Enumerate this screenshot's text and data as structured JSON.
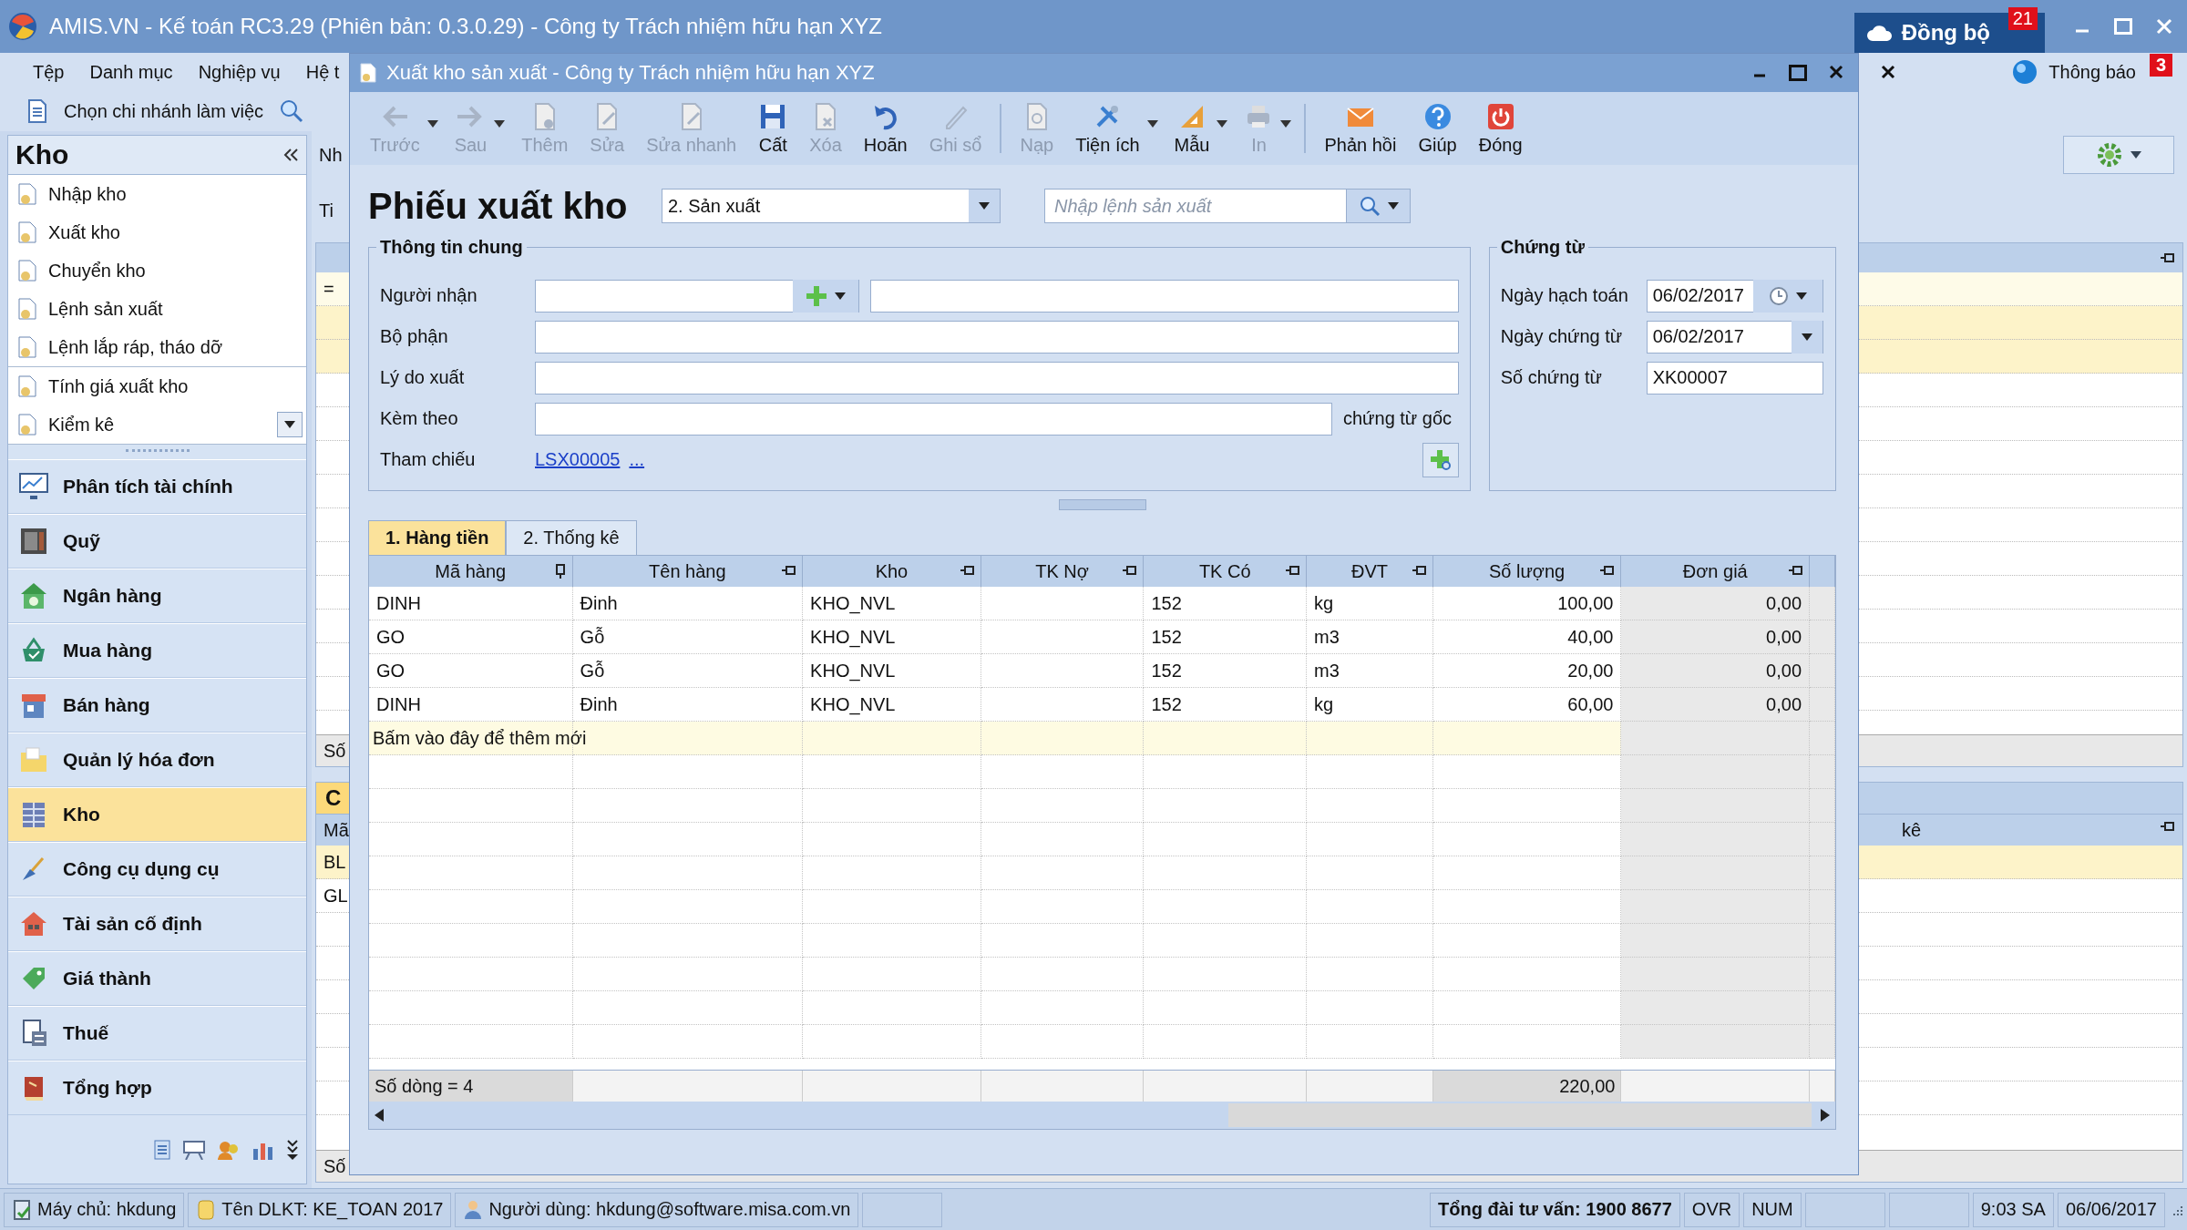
{
  "app_window": {
    "title": "AMIS.VN - Kế toán RC3.29 (Phiên bản: 0.3.0.29) - Công ty Trách nhiệm hữu hạn XYZ",
    "sync_button": {
      "label": "Đồng bộ",
      "badge": "21"
    }
  },
  "menu_bar": {
    "items": [
      "Tệp",
      "Danh mục",
      "Nghiệp vụ",
      "Hệ t"
    ],
    "notifications": {
      "label": "Thông báo",
      "badge": "3"
    }
  },
  "branch_bar": {
    "label": "Chọn chi nhánh làm việc"
  },
  "sidebar": {
    "title": "Kho",
    "item_groups": [
      [
        {
          "label": "Nhập kho",
          "has_menu": false
        },
        {
          "label": "Xuất kho",
          "has_menu": false
        },
        {
          "label": "Chuyển kho",
          "has_menu": false
        },
        {
          "label": "Lệnh sản xuất",
          "has_menu": false
        },
        {
          "label": "Lệnh lắp ráp, tháo dỡ",
          "has_menu": false
        }
      ],
      [
        {
          "label": "Tính giá xuất kho",
          "has_menu": false
        },
        {
          "label": "Kiểm kê",
          "has_menu": true
        }
      ]
    ],
    "modules": [
      {
        "label": "Phân tích tài chính",
        "selected": false
      },
      {
        "label": "Quỹ",
        "selected": false
      },
      {
        "label": "Ngân hàng",
        "selected": false
      },
      {
        "label": "Mua hàng",
        "selected": false
      },
      {
        "label": "Bán hàng",
        "selected": false
      },
      {
        "label": "Quản lý hóa đơn",
        "selected": false
      },
      {
        "label": "Kho",
        "selected": true
      },
      {
        "label": "Công cụ dụng cụ",
        "selected": false
      },
      {
        "label": "Tài sản cố định",
        "selected": false
      },
      {
        "label": "Giá thành",
        "selected": false
      },
      {
        "label": "Thuế",
        "selected": false
      },
      {
        "label": "Tổng hợp",
        "selected": false
      }
    ]
  },
  "background_panel": {
    "tab": "Nh",
    "label": "Ti",
    "upper_grid": {
      "filter_symbol": "=",
      "footer": "Số"
    },
    "lower_grid": {
      "header": "C",
      "columns": [
        "Mã",
        "kê"
      ],
      "rows": [
        "BL",
        "GL"
      ],
      "footer": "Số"
    }
  },
  "dialog": {
    "title": "Xuất kho sản xuất - Công ty Trách nhiệm hữu hạn XYZ",
    "toolbar_groups": [
      [
        {
          "label": "Trước",
          "disabled": true,
          "dropdown": true
        },
        {
          "label": "Sau",
          "disabled": true,
          "dropdown": true
        },
        {
          "label": "Thêm",
          "disabled": true,
          "dropdown": false
        },
        {
          "label": "Sửa",
          "disabled": true,
          "dropdown": false
        },
        {
          "label": "Sửa nhanh",
          "disabled": true,
          "dropdown": false
        },
        {
          "label": "Cất",
          "disabled": false,
          "dropdown": false
        },
        {
          "label": "Xóa",
          "disabled": true,
          "dropdown": false
        },
        {
          "label": "Hoãn",
          "disabled": false,
          "dropdown": false
        },
        {
          "label": "Ghi sổ",
          "disabled": true,
          "dropdown": false
        }
      ],
      [
        {
          "label": "Nạp",
          "disabled": true,
          "dropdown": false
        },
        {
          "label": "Tiện ích",
          "disabled": false,
          "dropdown": true
        },
        {
          "label": "Mẫu",
          "disabled": false,
          "dropdown": true
        },
        {
          "label": "In",
          "disabled": true,
          "dropdown": true
        }
      ],
      [
        {
          "label": "Phản hồi",
          "disabled": false,
          "dropdown": false
        },
        {
          "label": "Giúp",
          "disabled": false,
          "dropdown": false
        },
        {
          "label": "Đóng",
          "disabled": false,
          "dropdown": false
        }
      ]
    ],
    "voucher_title": "Phiếu xuất kho",
    "type_select": {
      "value": "2. Sản xuất"
    },
    "order_search": {
      "placeholder": "Nhập lệnh sản xuất"
    },
    "general_info": {
      "title": "Thông tin chung",
      "fields": [
        {
          "label": "Người nhận",
          "kind": "picker"
        },
        {
          "label": "Bộ phận",
          "kind": "text"
        },
        {
          "label": "Lý do xuất",
          "kind": "text"
        },
        {
          "label": "Kèm theo",
          "kind": "attach",
          "suffix": "chứng từ gốc"
        },
        {
          "label": "Tham chiếu",
          "kind": "link",
          "link": "LSX00005",
          "more": "..."
        }
      ]
    },
    "document": {
      "title": "Chứng từ",
      "fields": [
        {
          "label": "Ngày hạch toán",
          "value": "06/02/2017",
          "kind": "datetime"
        },
        {
          "label": "Ngày chứng từ",
          "value": "06/02/2017",
          "kind": "date"
        },
        {
          "label": "Số chứng từ",
          "value": "XK00007",
          "kind": "text"
        }
      ]
    },
    "tabs": [
      {
        "label": "1. Hàng tiền",
        "selected": true
      },
      {
        "label": "2. Thống kê",
        "selected": false
      }
    ],
    "grid": {
      "columns": [
        "Mã hàng",
        "Tên hàng",
        "Kho",
        "TK Nợ",
        "TK Có",
        "ĐVT",
        "Số lượng",
        "Đơn giá"
      ],
      "rows": [
        {
          "cells": [
            "DINH",
            "Đinh",
            "KHO_NVL",
            null,
            "152",
            "kg",
            "100,00",
            "0,00"
          ]
        },
        {
          "cells": [
            "GO",
            "Gỗ",
            "KHO_NVL",
            null,
            "152",
            "m3",
            "40,00",
            "0,00"
          ]
        },
        {
          "cells": [
            "GO",
            "Gỗ",
            "KHO_NVL",
            null,
            "152",
            "m3",
            "20,00",
            "0,00"
          ]
        },
        {
          "cells": [
            "DINH",
            "Đinh",
            "KHO_NVL",
            null,
            "152",
            "kg",
            "60,00",
            "0,00"
          ]
        }
      ],
      "add_row_hint": "Bấm vào đây để thêm mới",
      "footer": {
        "row_count": "Số dòng = 4",
        "quantity_total": "220,00"
      }
    }
  },
  "status_bar": {
    "items": [
      "Máy chủ: hkdung",
      "Tên DLKT: KE_TOAN 2017",
      "Người dùng: hkdung@software.misa.com.vn"
    ],
    "hotline": "Tổng đài tư vấn: 1900 8677",
    "indicators": [
      "OVR",
      "NUM"
    ],
    "time": "9:03 SA",
    "date": "06/06/2017"
  }
}
